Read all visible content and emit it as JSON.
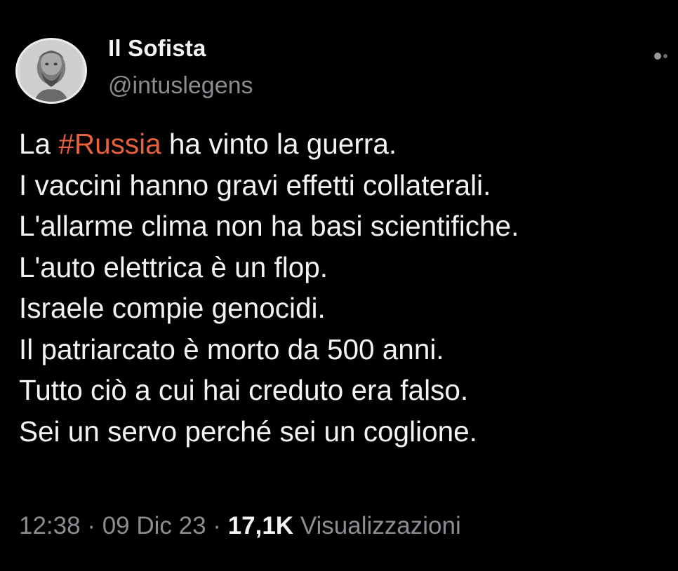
{
  "author": {
    "display_name": "Il Sofista",
    "handle": "@intuslegens"
  },
  "tweet": {
    "line1": {
      "before": "La ",
      "hashtag": "#Russia",
      "after": " ha vinto la guerra."
    },
    "lines": [
      "I vaccini hanno gravi effetti collaterali.",
      "L'allarme clima non ha basi scientifiche.",
      "L'auto elettrica è un flop.",
      "Israele compie genocidi.",
      "Il patriarcato è morto da 500 anni.",
      "Tutto ciò a cui hai creduto era falso.",
      "Sei un servo perché sei un coglione."
    ]
  },
  "meta": {
    "time": "12:38",
    "sep1": " · ",
    "date": "09 Dic 23",
    "sep2": " · ",
    "views_count": "17,1K",
    "views_label": " Visualizzazioni"
  },
  "icons": {
    "more": "more-options-icon"
  },
  "colors": {
    "background": "#000000",
    "hashtag": "#e8603c",
    "secondary_text": "#8a8d91"
  }
}
